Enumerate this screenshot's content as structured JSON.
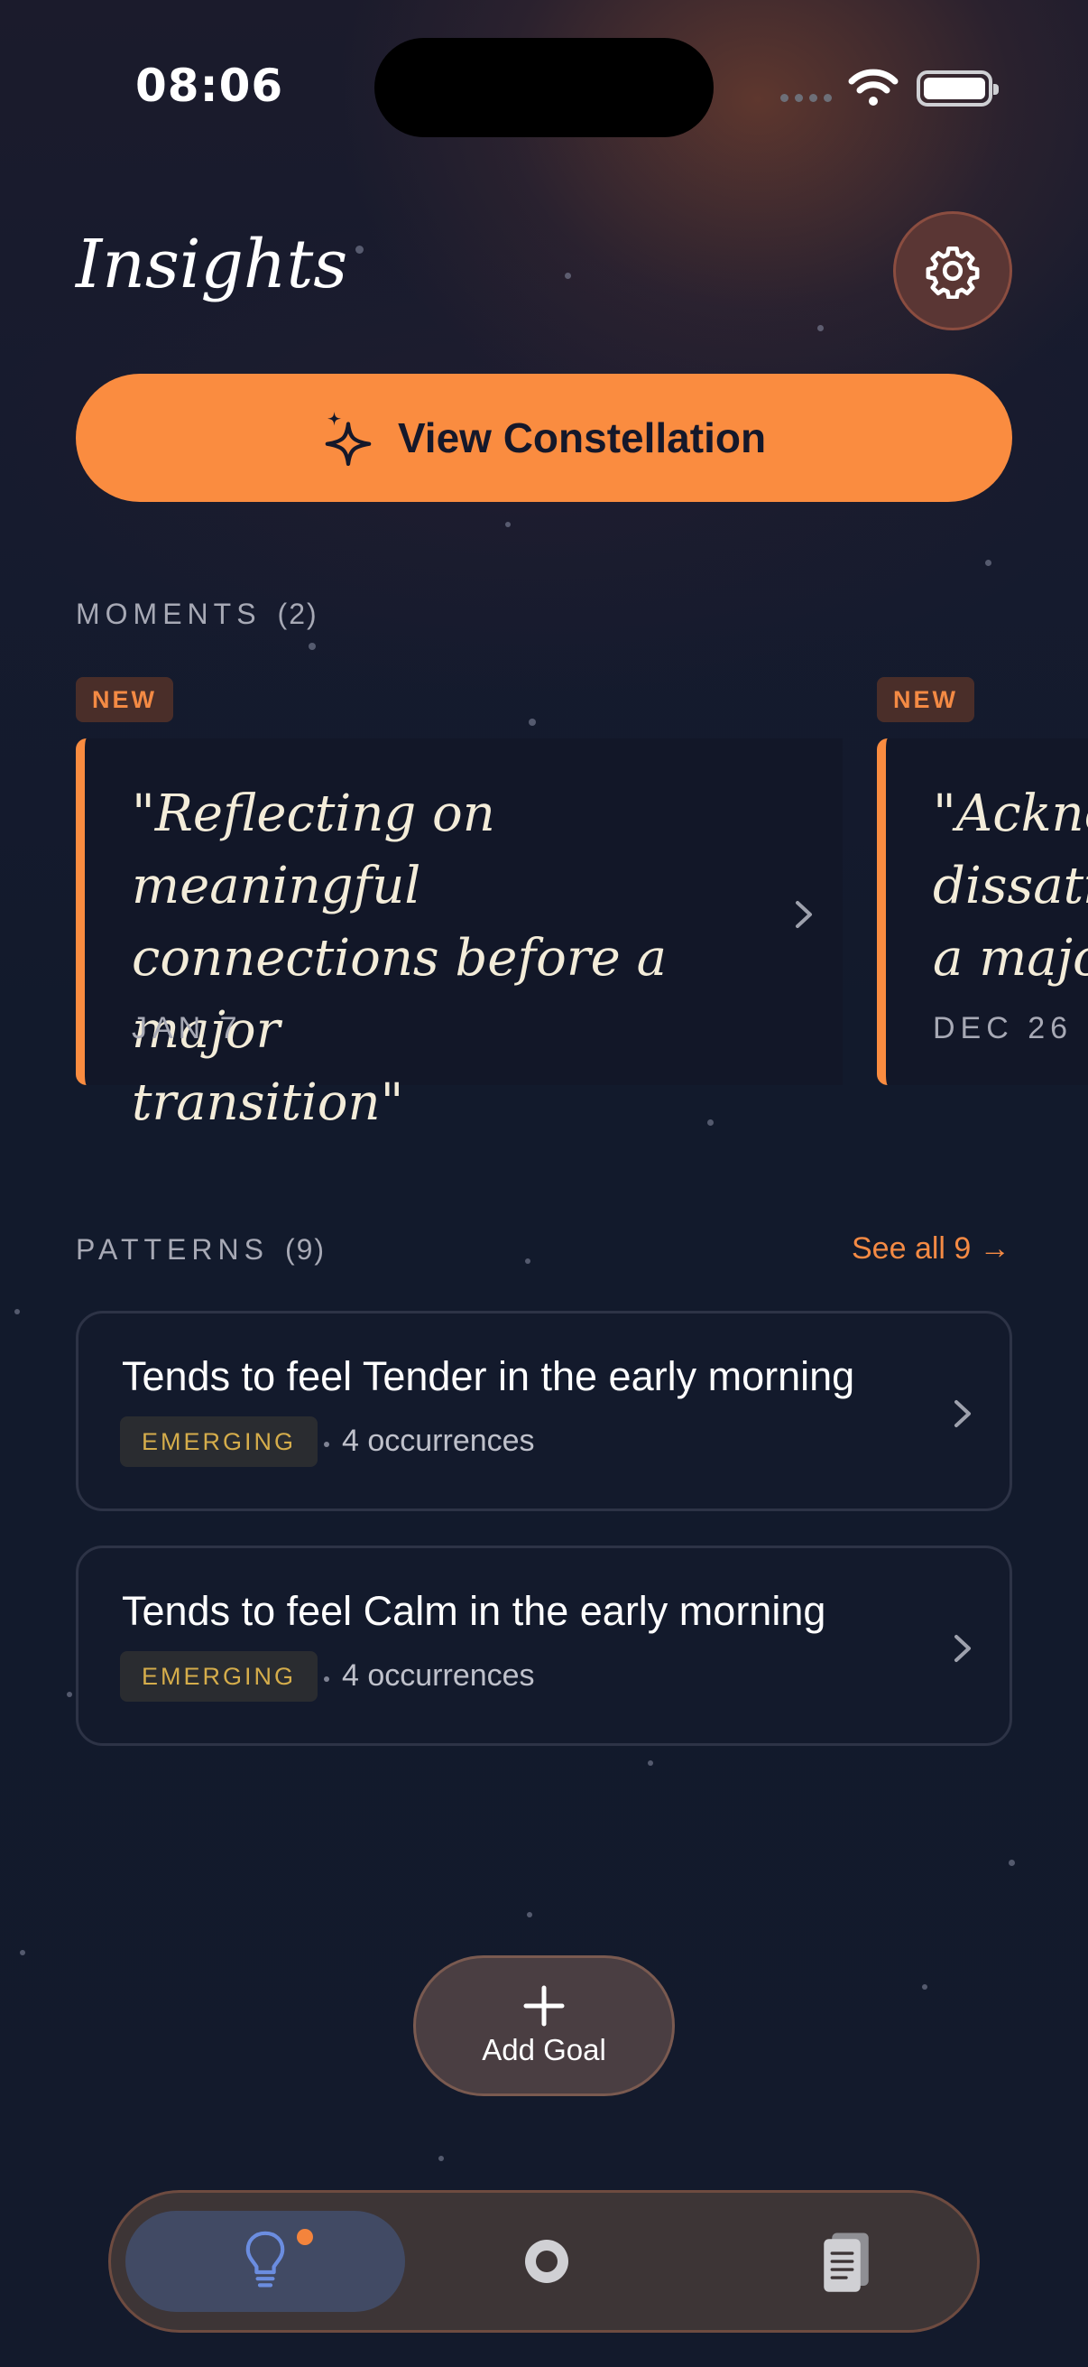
{
  "status_bar": {
    "time": "08:06"
  },
  "header": {
    "title": "Insights"
  },
  "constellation_button": {
    "label": "View Constellation"
  },
  "moments": {
    "label": "MOMENTS",
    "count": "(2)",
    "items": [
      {
        "badge": "NEW",
        "quote": "\"Reflecting on meaningful\nconnections before a major\ntransition\"",
        "date": "JAN 7"
      },
      {
        "badge": "NEW",
        "quote": "\"Acknow\ndissatisf\na major",
        "date": "DEC 26"
      }
    ]
  },
  "patterns": {
    "label": "PATTERNS",
    "count": "(9)",
    "see_all": "See all 9 →",
    "items": [
      {
        "title": "Tends to feel Tender in the early morning",
        "tag": "EMERGING",
        "meta": "4 occurrences"
      },
      {
        "title": "Tends to feel Calm in the early morning",
        "tag": "EMERGING",
        "meta": "4 occurrences"
      }
    ]
  },
  "add_goal": {
    "label": "Add Goal"
  },
  "colors": {
    "accent": "#fa8c40",
    "background": "#131a2c",
    "tag_text": "#d5ad4b",
    "tab_active_icon": "#6b8de0"
  },
  "icons": {
    "settings": "gear-icon",
    "constellation": "sparkle-icon",
    "tab_insights": "lightbulb-icon",
    "tab_mid": "ring-icon",
    "tab_journal": "journal-icon"
  }
}
